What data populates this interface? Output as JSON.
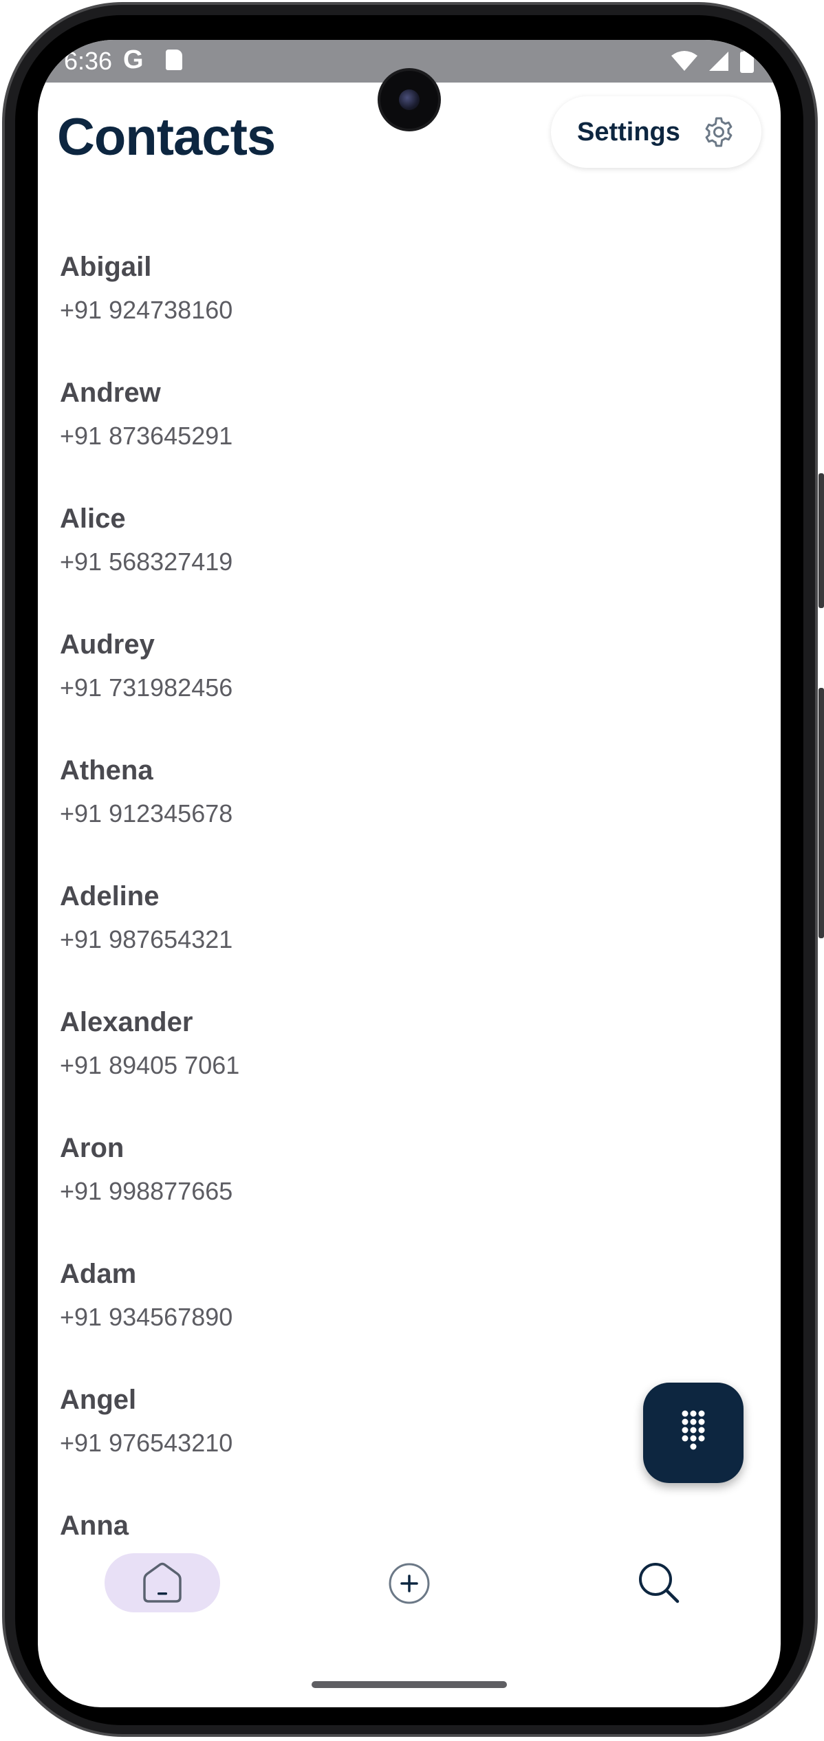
{
  "status_bar": {
    "time": "6:36",
    "google_icon": "G"
  },
  "header": {
    "title": "Contacts",
    "settings_label": "Settings"
  },
  "contacts": [
    {
      "name": "Abigail",
      "phone": "+91 924738160"
    },
    {
      "name": "Andrew",
      "phone": "+91 873645291"
    },
    {
      "name": "Alice",
      "phone": "+91 568327419"
    },
    {
      "name": "Audrey",
      "phone": "+91 731982456"
    },
    {
      "name": "Athena",
      "phone": "+91 912345678"
    },
    {
      "name": "Adeline",
      "phone": "+91 987654321"
    },
    {
      "name": "Alexander",
      "phone": "+91 89405 7061"
    },
    {
      "name": "Aron",
      "phone": "+91 998877665"
    },
    {
      "name": "Adam",
      "phone": "+91 934567890"
    },
    {
      "name": "Angel",
      "phone": "+91 976543210"
    },
    {
      "name": "Anna",
      "phone": ""
    }
  ],
  "bottom_nav": {
    "items": [
      "home-icon",
      "add-circle-icon",
      "search-icon"
    ],
    "selected": "home-icon"
  },
  "colors": {
    "primary": "#0d2640",
    "nav_selected_bg": "#e8e0f6",
    "status_bar": "#8e8f93"
  }
}
